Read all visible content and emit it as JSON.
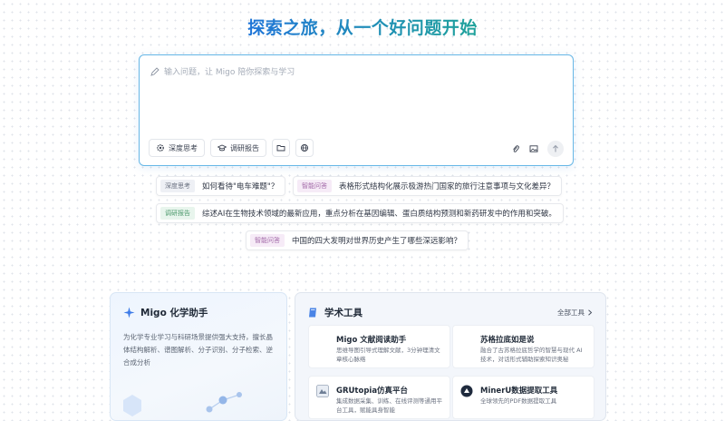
{
  "hero": {
    "title": "探索之旅，从一个好问题开始"
  },
  "input": {
    "placeholder": "输入问题，让 Migo 陪你探索与学习",
    "buttons": {
      "deep_think": "深度思考",
      "research_report": "调研报告"
    }
  },
  "suggestions": [
    {
      "tag": "深度思考",
      "text": "如何看待\"电车难题\"？"
    },
    {
      "tag": "智能问答",
      "text": "表格形式结构化展示极游热门国家的旅行注意事项与文化差异？"
    },
    {
      "tag": "调研报告",
      "text": "综述AI在生物技术领域的最新应用，重点分析在基因编辑、蛋白质结构预测和新药研发中的作用和突破。"
    },
    {
      "tag": "智能问答",
      "text": "中国的四大发明对世界历史产生了哪些深远影响？"
    }
  ],
  "chem_card": {
    "title": "Migo 化学助手",
    "description": "为化学专业学习与科研场景提供强大支持，擅长晶体结构解析、谱图解析、分子识别、分子检索、逆合成分析"
  },
  "tools": {
    "title": "学术工具",
    "all_label": "全部工具",
    "items": [
      {
        "name": "Migo 文献阅读助手",
        "desc": "思维导图引导式理解文献，3分钟理清文章核心脉络"
      },
      {
        "name": "苏格拉底如是说",
        "desc": "融合了古苏格拉底哲学的智慧与现代 AI 技术，对话形式辅助探索知识奥秘"
      },
      {
        "name": "GRUtopia仿真平台",
        "desc": "集成数据采集、训练、在线评测等通用平台工具，赋能具身智能"
      },
      {
        "name": "MinerU数据提取工具",
        "desc": "全球领先的PDF数据提取工具"
      }
    ]
  },
  "colors": {
    "accent_blue": "#1f6fe0",
    "accent_green": "#21b08a",
    "input_border": "#67b7e6"
  }
}
